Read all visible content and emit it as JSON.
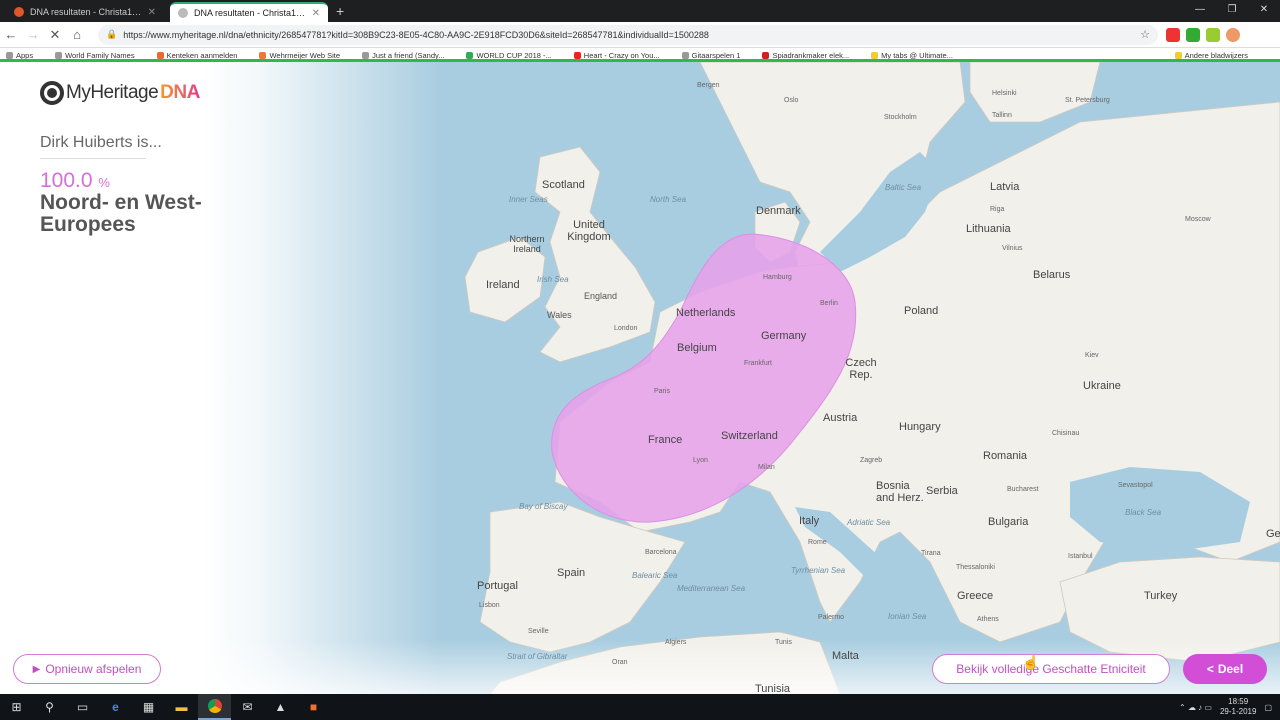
{
  "browser": {
    "tabs": [
      {
        "title": "DNA resultaten - Christa1980 ge",
        "active": false
      },
      {
        "title": "DNA resultaten - Christa1980 ge",
        "active": true
      }
    ],
    "url": "https://www.myheritage.nl/dna/ethnicity/268547781?kitId=308B9C23-8E05-4C80-AA9C-2E918FCD30D6&siteId=268547781&individualId=1500288",
    "bookmarks": [
      "Apps",
      "World Family Names",
      "Kenteken aanmelden",
      "Wehrmeijer Web Site",
      "Just a friend (Sandy...",
      "WORLD CUP 2018 -...",
      "Heart - Crazy on You...",
      "Gitaarspelen 1",
      "Spiadrankmaker elek...",
      "My tabs @ Ultimate..."
    ],
    "bookmarks_right": "Andere bladwijzers"
  },
  "logo": {
    "text": "MyHeritage",
    "suffix": "DNA"
  },
  "result": {
    "person_line": "Dirk Huiberts is...",
    "percentage": "100.0",
    "percent_sign": "%",
    "ethnicity": "Noord- en West-Europees"
  },
  "buttons": {
    "replay": "Opnieuw afspelen",
    "full_ethnicity": "Bekijk volledige Geschatte Etniciteit",
    "share": "Deel"
  },
  "map_labels": {
    "countries": [
      "Scotland",
      "United Kingdom",
      "Northern Ireland",
      "Ireland",
      "England",
      "Wales",
      "Denmark",
      "Netherlands",
      "Belgium",
      "Germany",
      "France",
      "Switzerland",
      "Austria",
      "Czech Rep.",
      "Poland",
      "Latvia",
      "Lithuania",
      "Belarus",
      "Ukraine",
      "Hungary",
      "Romania",
      "Bosnia and Herz.",
      "Serbia",
      "Bulgaria",
      "Italy",
      "Spain",
      "Portugal",
      "Greece",
      "Turkey",
      "Malta",
      "Tunisia",
      "Ge"
    ],
    "cities": [
      "Bergen",
      "Oslo",
      "Stockholm",
      "Helsinki",
      "St. Petersburg",
      "Tallinn",
      "Moscow",
      "Riga",
      "Vilnius",
      "Hamburg",
      "Berlin",
      "London",
      "Paris",
      "Frankfurt",
      "Lyon",
      "Milan",
      "Zagreb",
      "Rome",
      "Barcelona",
      "Lisbon",
      "Seville",
      "Algiers",
      "Tunis",
      "Palermo",
      "Tirana",
      "Thessaloniki",
      "Athens",
      "Bucharest",
      "Sevastopol",
      "Istanbul",
      "Kiev",
      "Chisinau",
      "Oran"
    ],
    "seas": [
      "North Sea",
      "Inner Seas",
      "Irish Sea",
      "Baltic Sea",
      "Bay of Biscay",
      "Adriatic Sea",
      "Tyrrhenian Sea",
      "Balearic Sea",
      "Mediterranean Sea",
      "Ionian Sea",
      "Black Sea",
      "Strait of Gibraltar"
    ]
  },
  "taskbar": {
    "time": "18:59",
    "date": "29-1-2019"
  },
  "colors": {
    "accent": "#d24ed6",
    "region_fill": "#e8a6ec",
    "sea": "#a9cde0",
    "land": "#f2f0ea"
  }
}
